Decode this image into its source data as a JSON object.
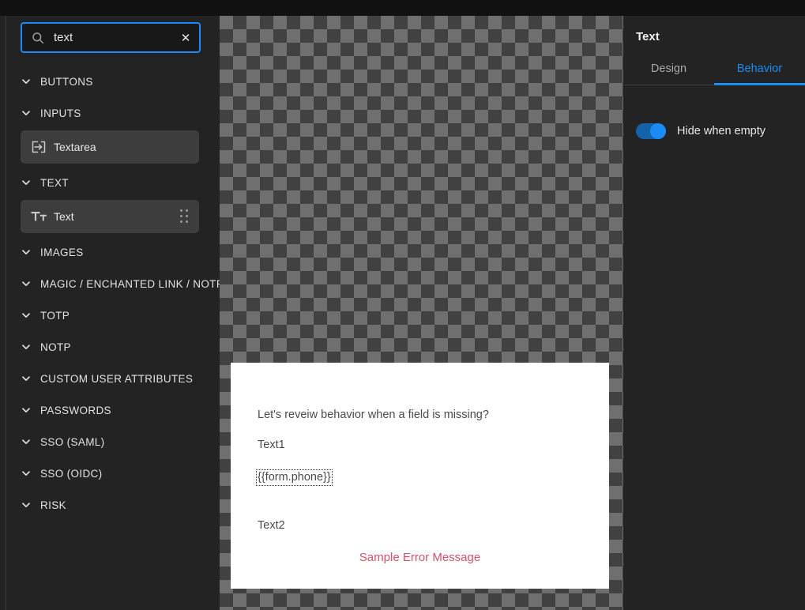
{
  "colors": {
    "accent": "#1a8cf5",
    "sidebar_bg": "#232323",
    "top_bar_bg": "#111111",
    "panel_item_bg": "#3d3d3d",
    "error_text": "#ce5268",
    "card_text": "#4a4a4a",
    "checker_light": "#6f6f6f",
    "checker_dark": "#414141"
  },
  "search": {
    "value": "text",
    "placeholder": "Search",
    "icon": "search-icon",
    "clear_icon": "✕"
  },
  "sidebar": {
    "sections": [
      {
        "label": "BUTTONS",
        "icon": "chevron-down-icon",
        "items": []
      },
      {
        "label": "INPUTS",
        "icon": "chevron-down-icon",
        "items": [
          {
            "label": "Textarea",
            "icon": "textarea-icon",
            "selected": false,
            "draggable": false
          }
        ]
      },
      {
        "label": "TEXT",
        "icon": "chevron-down-icon",
        "items": [
          {
            "label": "Text",
            "icon": "text-format-icon",
            "selected": true,
            "draggable": true
          }
        ]
      },
      {
        "label": "IMAGES",
        "icon": "chevron-down-icon",
        "items": []
      },
      {
        "label": "MAGIC / ENCHANTED LINK / NOTP",
        "icon": "chevron-down-icon",
        "items": []
      },
      {
        "label": "TOTP",
        "icon": "chevron-down-icon",
        "items": []
      },
      {
        "label": "NOTP",
        "icon": "chevron-down-icon",
        "items": []
      },
      {
        "label": "CUSTOM USER ATTRIBUTES",
        "icon": "chevron-down-icon",
        "items": []
      },
      {
        "label": "PASSWORDS",
        "icon": "chevron-down-icon",
        "items": []
      },
      {
        "label": "SSO (SAML)",
        "icon": "chevron-down-icon",
        "items": []
      },
      {
        "label": "SSO (OIDC)",
        "icon": "chevron-down-icon",
        "items": []
      },
      {
        "label": "RISK",
        "icon": "chevron-down-icon",
        "items": []
      }
    ]
  },
  "canvas": {
    "card": {
      "lines": [
        {
          "text": "Let's reveiw behavior when a field is missing?",
          "selected": false
        },
        {
          "text": "Text1",
          "selected": false
        },
        {
          "text": "{{form.phone}}",
          "selected": true
        },
        {
          "text": "Text2",
          "selected": false
        }
      ],
      "error_message": "Sample Error Message"
    }
  },
  "right_panel": {
    "title": "Text",
    "tabs": [
      {
        "label": "Design",
        "active": false
      },
      {
        "label": "Behavior",
        "active": true
      }
    ],
    "settings": [
      {
        "label": "Hide when empty",
        "type": "toggle",
        "value": "on"
      }
    ]
  }
}
